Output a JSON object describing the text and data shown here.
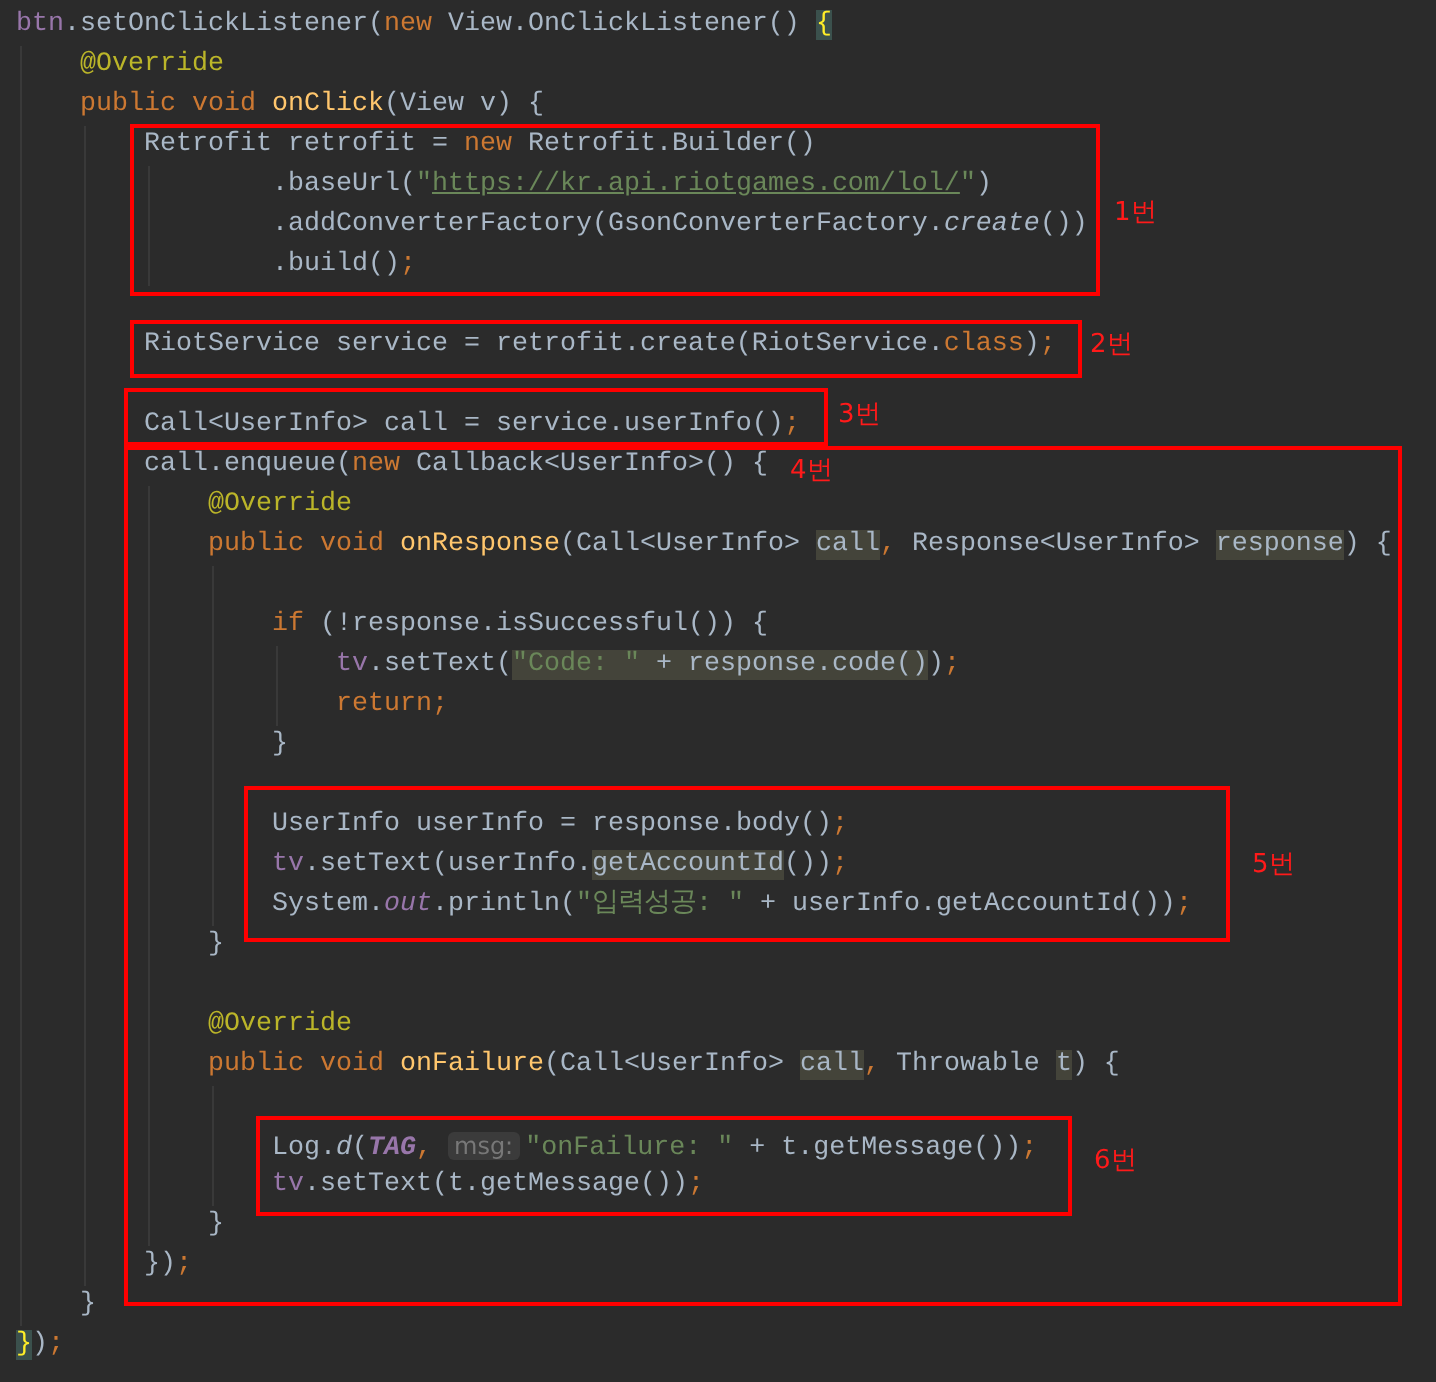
{
  "code_lines": [
    {
      "kind": "code",
      "tokens": [
        {
          "kind": "field",
          "text": "btn"
        },
        {
          "kind": "plain",
          "text": ".setOnClickListener("
        },
        {
          "kind": "keyword",
          "text": "new"
        },
        {
          "kind": "plain",
          "text": " View.OnClickListener() "
        },
        {
          "kind": "brace-match",
          "text": "{"
        }
      ],
      "children": [
        {
          "kind": "code",
          "tokens": [
            {
              "kind": "annotation",
              "text": "@Override"
            }
          ]
        },
        {
          "kind": "code",
          "tokens": [
            {
              "kind": "keyword",
              "text": "public void "
            },
            {
              "kind": "declaration",
              "text": "onClick"
            },
            {
              "kind": "plain",
              "text": "(View v) {"
            }
          ],
          "children": [
            {
              "kind": "code",
              "tokens": [
                {
                  "kind": "plain",
                  "text": "Retrofit retrofit = "
                },
                {
                  "kind": "keyword",
                  "text": "new"
                },
                {
                  "kind": "plain",
                  "text": " Retrofit.Builder()"
                }
              ],
              "children": [
                {
                  "kind": "continuation",
                  "tokens": [
                    {
                      "kind": "plain",
                      "text": ".baseUrl("
                    },
                    {
                      "kind": "string",
                      "text": "\""
                    },
                    {
                      "kind": "url",
                      "text": "https://kr.api.riotgames.com/lol/"
                    },
                    {
                      "kind": "string",
                      "text": "\""
                    },
                    {
                      "kind": "plain",
                      "text": ")"
                    }
                  ]
                },
                {
                  "kind": "continuation",
                  "tokens": [
                    {
                      "kind": "plain",
                      "text": ".addConverterFactory(GsonConverterFactory."
                    },
                    {
                      "kind": "italic",
                      "text": "create"
                    },
                    {
                      "kind": "plain",
                      "text": "())"
                    }
                  ]
                },
                {
                  "kind": "continuation",
                  "tokens": [
                    {
                      "kind": "plain",
                      "text": ".build()"
                    },
                    {
                      "kind": "keyword",
                      "text": ";"
                    }
                  ]
                }
              ]
            },
            {
              "kind": "blank"
            },
            {
              "kind": "code",
              "tokens": [
                {
                  "kind": "plain",
                  "text": "RiotService service = retrofit.create(RiotService."
                },
                {
                  "kind": "keyword",
                  "text": "class"
                },
                {
                  "kind": "plain",
                  "text": ")"
                },
                {
                  "kind": "keyword",
                  "text": ";"
                }
              ]
            },
            {
              "kind": "blank"
            },
            {
              "kind": "code",
              "tokens": [
                {
                  "kind": "plain",
                  "text": "Call<UserInfo> call = service.userInfo()"
                },
                {
                  "kind": "keyword",
                  "text": ";"
                }
              ]
            },
            {
              "kind": "code",
              "tokens": [
                {
                  "kind": "plain",
                  "text": "call.enqueue("
                },
                {
                  "kind": "keyword",
                  "text": "new"
                },
                {
                  "kind": "plain",
                  "text": " Callback<UserInfo>() {"
                }
              ],
              "children": [
                {
                  "kind": "code",
                  "tokens": [
                    {
                      "kind": "annotation",
                      "text": "@Override"
                    }
                  ]
                },
                {
                  "kind": "code",
                  "tokens": [
                    {
                      "kind": "keyword",
                      "text": "public void "
                    },
                    {
                      "kind": "declaration",
                      "text": "onResponse"
                    },
                    {
                      "kind": "plain",
                      "text": "(Call<UserInfo> "
                    },
                    {
                      "kind": "usage",
                      "text": "call"
                    },
                    {
                      "kind": "keyword",
                      "text": ","
                    },
                    {
                      "kind": "plain",
                      "text": " Response<UserInfo> "
                    },
                    {
                      "kind": "usage",
                      "text": "response"
                    },
                    {
                      "kind": "plain",
                      "text": ") {"
                    }
                  ],
                  "children": [
                    {
                      "kind": "blank"
                    },
                    {
                      "kind": "code",
                      "tokens": [
                        {
                          "kind": "keyword",
                          "text": "if"
                        },
                        {
                          "kind": "plain",
                          "text": " (!response.isSuccessful()) {"
                        }
                      ],
                      "children": [
                        {
                          "kind": "code",
                          "tokens": [
                            {
                              "kind": "field",
                              "text": "tv"
                            },
                            {
                              "kind": "plain",
                              "text": ".setText("
                            },
                            {
                              "kind": "string-usage",
                              "text": "\"Code: \""
                            },
                            {
                              "kind": "usage",
                              "text": " + response.code()"
                            },
                            {
                              "kind": "plain",
                              "text": ")"
                            },
                            {
                              "kind": "keyword",
                              "text": ";"
                            }
                          ]
                        },
                        {
                          "kind": "code",
                          "tokens": [
                            {
                              "kind": "keyword",
                              "text": "return;"
                            }
                          ]
                        }
                      ]
                    },
                    {
                      "kind": "code",
                      "tokens": [
                        {
                          "kind": "plain",
                          "text": "}"
                        }
                      ]
                    },
                    {
                      "kind": "blank"
                    },
                    {
                      "kind": "code",
                      "tokens": [
                        {
                          "kind": "plain",
                          "text": "UserInfo userInfo = response.body()"
                        },
                        {
                          "kind": "keyword",
                          "text": ";"
                        }
                      ]
                    },
                    {
                      "kind": "code",
                      "tokens": [
                        {
                          "kind": "field",
                          "text": "tv"
                        },
                        {
                          "kind": "plain",
                          "text": ".setText(userInfo."
                        },
                        {
                          "kind": "usage",
                          "text": "getAccountId"
                        },
                        {
                          "kind": "plain",
                          "text": "())"
                        },
                        {
                          "kind": "keyword",
                          "text": ";"
                        }
                      ]
                    },
                    {
                      "kind": "code",
                      "tokens": [
                        {
                          "kind": "plain",
                          "text": "System."
                        },
                        {
                          "kind": "static",
                          "text": "out"
                        },
                        {
                          "kind": "plain",
                          "text": ".println("
                        },
                        {
                          "kind": "string",
                          "text": "\"입력성공: \""
                        },
                        {
                          "kind": "plain",
                          "text": " + userInfo.getAccountId())"
                        },
                        {
                          "kind": "keyword",
                          "text": ";"
                        }
                      ]
                    }
                  ]
                },
                {
                  "kind": "code",
                  "tokens": [
                    {
                      "kind": "plain",
                      "text": "}"
                    }
                  ]
                },
                {
                  "kind": "blank"
                },
                {
                  "kind": "code",
                  "tokens": [
                    {
                      "kind": "annotation",
                      "text": "@Override"
                    }
                  ]
                },
                {
                  "kind": "code",
                  "tokens": [
                    {
                      "kind": "keyword",
                      "text": "public void "
                    },
                    {
                      "kind": "declaration",
                      "text": "onFailure"
                    },
                    {
                      "kind": "plain",
                      "text": "(Call<UserInfo> "
                    },
                    {
                      "kind": "usage",
                      "text": "call"
                    },
                    {
                      "kind": "keyword",
                      "text": ","
                    },
                    {
                      "kind": "plain",
                      "text": " Throwable "
                    },
                    {
                      "kind": "usage",
                      "text": "t"
                    },
                    {
                      "kind": "plain",
                      "text": ") {"
                    }
                  ],
                  "children": [
                    {
                      "kind": "blank"
                    },
                    {
                      "kind": "code",
                      "tokens": [
                        {
                          "kind": "plain",
                          "text": "Log."
                        },
                        {
                          "kind": "italic",
                          "text": "d"
                        },
                        {
                          "kind": "plain",
                          "text": "("
                        },
                        {
                          "kind": "static-bold",
                          "text": "TAG"
                        },
                        {
                          "kind": "keyword",
                          "text": ","
                        },
                        {
                          "kind": "hint",
                          "text": "msg:"
                        },
                        {
                          "kind": "string",
                          "text": "\"onFailure: \""
                        },
                        {
                          "kind": "plain",
                          "text": " + t.getMessage())"
                        },
                        {
                          "kind": "keyword",
                          "text": ";"
                        }
                      ]
                    },
                    {
                      "kind": "code",
                      "tokens": [
                        {
                          "kind": "field",
                          "text": "tv"
                        },
                        {
                          "kind": "plain",
                          "text": ".setText(t.getMessage())"
                        },
                        {
                          "kind": "keyword",
                          "text": ";"
                        }
                      ]
                    }
                  ]
                },
                {
                  "kind": "code",
                  "tokens": [
                    {
                      "kind": "plain",
                      "text": "}"
                    }
                  ]
                }
              ]
            },
            {
              "kind": "code",
              "tokens": [
                {
                  "kind": "plain",
                  "text": "})"
                },
                {
                  "kind": "keyword",
                  "text": ";"
                }
              ]
            }
          ]
        },
        {
          "kind": "code",
          "tokens": [
            {
              "kind": "plain",
              "text": "}"
            }
          ]
        }
      ]
    },
    {
      "kind": "code",
      "tokens": [
        {
          "kind": "brace-match",
          "text": "}"
        },
        {
          "kind": "plain",
          "text": ")"
        },
        {
          "kind": "keyword",
          "text": ";"
        }
      ]
    }
  ],
  "annotations": [
    {
      "label": "1번"
    },
    {
      "label": "2번"
    },
    {
      "label": "3번"
    },
    {
      "label": "4번"
    },
    {
      "label": "5번"
    },
    {
      "label": "6번"
    }
  ]
}
